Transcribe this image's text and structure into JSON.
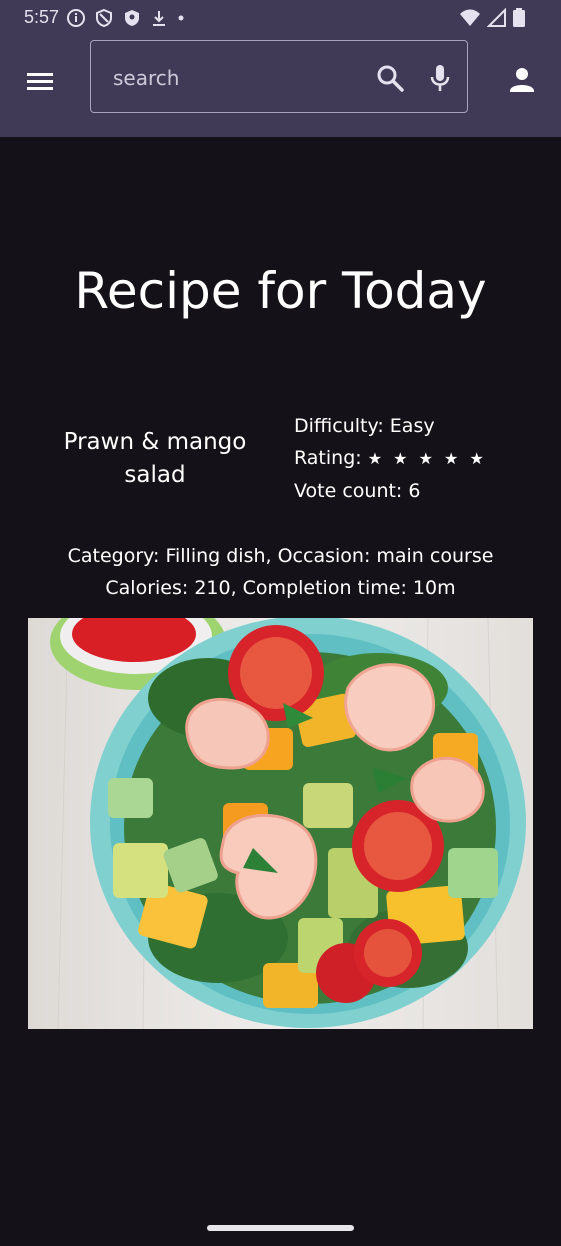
{
  "status_bar": {
    "time": "5:57",
    "left_icons": [
      "info-icon",
      "shield-icon",
      "privacy-shield-icon",
      "download-icon",
      "dot-icon"
    ],
    "right_icons": [
      "wifi-icon",
      "signal-icon",
      "battery-icon"
    ]
  },
  "app_bar": {
    "menu_icon": "hamburger-menu-icon",
    "search": {
      "placeholder": "search",
      "value": ""
    },
    "search_icon": "search-icon",
    "mic_icon": "microphone-icon",
    "account_icon": "person-icon",
    "background": "#403a57"
  },
  "page": {
    "title": "Recipe for Today",
    "recipe_name": "Prawn & mango salad",
    "difficulty_label": "Difficulty: Easy",
    "rating_label": "Rating:",
    "rating_value": 5,
    "rating_stars": "★ ★ ★ ★ ★",
    "vote_count_label": "Vote count: 6",
    "category_line": "Category: Filling dish, Occasion: main course",
    "calories_line": "Calories: 210, Completion time: 10m",
    "background": "#141218"
  }
}
